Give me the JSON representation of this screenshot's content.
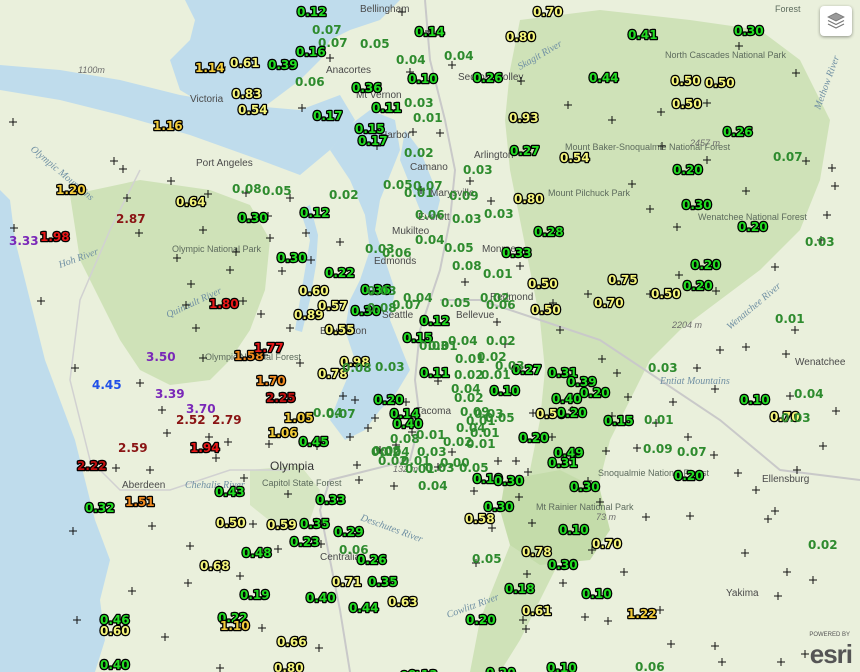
{
  "places": [
    {
      "name": "Bellingham",
      "cls": "place"
    },
    {
      "name": "Anacortes",
      "cls": "place"
    },
    {
      "name": "Sedro-Woolley",
      "cls": "place"
    },
    {
      "name": "Mt Vernon",
      "cls": "place"
    },
    {
      "name": "Harbor",
      "cls": "place"
    },
    {
      "name": "Camano",
      "cls": "place"
    },
    {
      "name": "Arlington",
      "cls": "place"
    },
    {
      "name": "Marysville",
      "cls": "place"
    },
    {
      "name": "Everett",
      "cls": "place"
    },
    {
      "name": "Mukilteo",
      "cls": "place"
    },
    {
      "name": "Edmonds",
      "cls": "place"
    },
    {
      "name": "Monroe",
      "cls": "place"
    },
    {
      "name": "Seattle",
      "cls": "place"
    },
    {
      "name": "Bellevue",
      "cls": "place"
    },
    {
      "name": "Redmond",
      "cls": "place"
    },
    {
      "name": "Bremerton",
      "cls": "place"
    },
    {
      "name": "Tacoma",
      "cls": "place"
    },
    {
      "name": "Olympia",
      "cls": "place big"
    },
    {
      "name": "Centralia",
      "cls": "place"
    },
    {
      "name": "Aberdeen",
      "cls": "place"
    },
    {
      "name": "Port Angeles",
      "cls": "place"
    },
    {
      "name": "Victoria",
      "cls": "place"
    },
    {
      "name": "Wenatchee",
      "cls": "place"
    },
    {
      "name": "Ellensburg",
      "cls": "place"
    },
    {
      "name": "Yakima",
      "cls": "place"
    },
    {
      "name": "Olympic National Park",
      "cls": "area"
    },
    {
      "name": "Olympic National Forest",
      "cls": "area"
    },
    {
      "name": "Mount Baker-Snoqualmie National Forest",
      "cls": "area"
    },
    {
      "name": "Mount Pilchuck Park",
      "cls": "area"
    },
    {
      "name": "Wenatchee National Forest",
      "cls": "area"
    },
    {
      "name": "Snoqualmie National Forest",
      "cls": "area"
    },
    {
      "name": "Mt Rainier National Park",
      "cls": "area"
    },
    {
      "name": "Capitol State Forest",
      "cls": "area"
    },
    {
      "name": "North Cascades National Park",
      "cls": "area"
    },
    {
      "name": "Forest",
      "cls": "area"
    },
    {
      "name": "Deschutes River",
      "cls": "water"
    },
    {
      "name": "Chehalis River",
      "cls": "water"
    },
    {
      "name": "Skagit River",
      "cls": "water"
    },
    {
      "name": "Hoh River",
      "cls": "water"
    },
    {
      "name": "Quinault River",
      "cls": "water"
    },
    {
      "name": "Wenatchee River",
      "cls": "water"
    },
    {
      "name": "Cowlitz River",
      "cls": "water"
    },
    {
      "name": "Olympic Mountains",
      "cls": "water"
    },
    {
      "name": "Entiat Mountains",
      "cls": "water"
    },
    {
      "name": "Methow River",
      "cls": "water"
    },
    {
      "name": "1100m",
      "cls": "elev"
    },
    {
      "name": "2457 m",
      "cls": "elev"
    },
    {
      "name": "2204 m",
      "cls": "elev"
    },
    {
      "name": "132 m",
      "cls": "elev"
    },
    {
      "name": "73 m",
      "cls": "elev"
    }
  ],
  "precip_values": [
    "0.12",
    "0.07",
    "0.07",
    "0.16",
    "0.39",
    "0.61",
    "1.14",
    "0.06",
    "0.36",
    "0.83",
    "0.54",
    "0.17",
    "0.11",
    "0.15",
    "0.17",
    "1.16",
    "0.14",
    "0.10",
    "0.26",
    "0.80",
    "0.70",
    "0.41",
    "0.30",
    "0.44",
    "0.50",
    "0.50",
    "0.50",
    "0.93",
    "0.27",
    "0.54",
    "0.26",
    "0.20",
    "0.30",
    "0.20",
    "0.20",
    "0.20",
    "0.33",
    "0.75",
    "0.70",
    "0.50",
    "0.50",
    "0.50",
    "0.80",
    "0.28",
    "0.30",
    "0.08",
    "0.05",
    "0.64",
    "1.20",
    "2.87",
    "3.33",
    "1.98",
    "0.30",
    "0.22",
    "0.60",
    "0.89",
    "0.57",
    "0.55",
    "1.80",
    "0.30",
    "0.36",
    "0.12",
    "0.15",
    "0.98",
    "0.78",
    "1.58",
    "1.77",
    "3.50",
    "4.45",
    "3.39",
    "3.70",
    "1.70",
    "2.25",
    "2.52",
    "2.79",
    "2.59",
    "1.94",
    "2.22",
    "1.05",
    "1.06",
    "0.45",
    "0.11",
    "0.20",
    "0.14",
    "0.40",
    "0.10",
    "0.31",
    "0.27",
    "0.39",
    "0.40",
    "0.20",
    "0.15",
    "0.50",
    "0.49",
    "0.31",
    "0.10",
    "0.20",
    "0.10",
    "0.70",
    "0.20",
    "0.20",
    "0.43",
    "1.51",
    "0.32",
    "0.50",
    "0.59",
    "0.35",
    "0.29",
    "0.23",
    "0.48",
    "0.68",
    "0.33",
    "0.58",
    "0.30",
    "0.30",
    "0.30",
    "0.10",
    "0.70",
    "0.78",
    "0.30",
    "0.18",
    "0.71",
    "0.35",
    "0.26",
    "0.19",
    "0.40",
    "0.44",
    "0.63",
    "0.20",
    "0.10",
    "1.22",
    "0.61",
    "0.46",
    "0.60",
    "0.22",
    "1.10",
    "0.66",
    "0.40",
    "0.80",
    "0.10",
    "0.20",
    "0.10",
    "0.06",
    "0.13",
    "0.04",
    "0.03",
    "0.05",
    "0.04",
    "0.01",
    "0.02",
    "0.03",
    "0.01",
    "0.09",
    "0.02",
    "0.12",
    "0.05",
    "0.07",
    "0.03",
    "0.06",
    "0.03",
    "0.04",
    "0.03",
    "0.05",
    "0.06",
    "0.08",
    "0.01",
    "0.02",
    "0.03",
    "0.04",
    "0.05",
    "0.06",
    "0.07",
    "0.08",
    "0.01",
    "0.02",
    "0.03",
    "0.04",
    "0.01",
    "0.02",
    "0.03",
    "0.02",
    "0.01",
    "0.04",
    "0.02",
    "0.09",
    "0.01",
    "0.03",
    "0.05",
    "0.04",
    "0.01",
    "0.01",
    "0.02",
    "0.03",
    "0.04",
    "0.02",
    "0.03",
    "0.00",
    "0.04",
    "0.01",
    "0.02",
    "0.01",
    "0.01",
    "0.05",
    "0.03",
    "0.09",
    "0.07",
    "0.01",
    "0.04",
    "0.01",
    "0.03",
    "0.07",
    "0.02",
    "0.03",
    "0.04",
    "0.05",
    "0.06",
    "0.07",
    "0.08",
    "0.03",
    "0.05",
    "0.08"
  ],
  "map_controls": {
    "layers_icon": "layers-icon"
  },
  "attribution": {
    "powered_by": "POWERED BY",
    "logo": "esri"
  }
}
